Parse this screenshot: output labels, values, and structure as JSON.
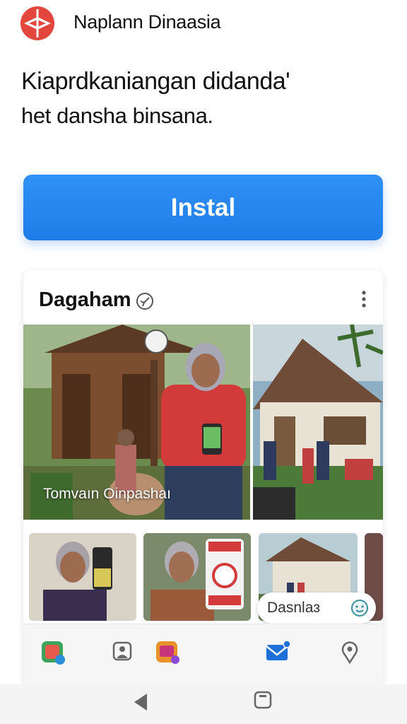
{
  "header": {
    "app_name": "Naplann Dinaasia",
    "logo_icon": "app-logo-icon",
    "logo_color": "#e2463d"
  },
  "hero_text": {
    "headline": "Kiaprdkaniangan didanda'",
    "subline": "het dansha binsana."
  },
  "install": {
    "label": "Instal",
    "color": "#2386ee"
  },
  "card": {
    "title": "Dagaham",
    "title_icon": "verified-icon",
    "menu_icon": "more-vertical-icon",
    "hero_caption": "Tomvaın Oinpashaı",
    "chip_label": "Dasnlaɜ",
    "chip_icon": "smiley-icon"
  },
  "bottom_nav": {
    "items": [
      {
        "icon": "photos-app-icon"
      },
      {
        "icon": "contacts-app-icon"
      },
      {
        "icon": "games-app-icon"
      },
      {
        "icon": "mail-app-icon"
      },
      {
        "icon": "location-pin-icon"
      }
    ]
  },
  "system_bar": {
    "back_icon": "back-triangle-icon",
    "home_icon": "home-square-icon"
  }
}
